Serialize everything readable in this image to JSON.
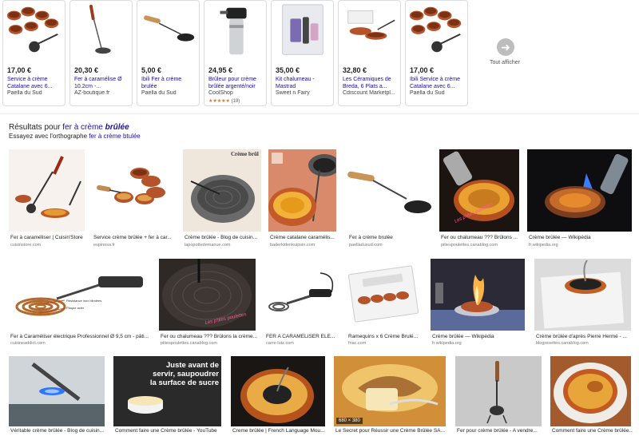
{
  "shopping": {
    "items": [
      {
        "price": "17,00 €",
        "title": "Service à crème Catalane avec 6...",
        "seller": "Paella du Sud",
        "rating": "",
        "rating_count": ""
      },
      {
        "price": "20,30 €",
        "title": "Fer à caramélise Ø 10.2cm -...",
        "seller": "AZ-boutique.fr",
        "rating": "",
        "rating_count": ""
      },
      {
        "price": "5,00 €",
        "title": "Ibili Fer à crème brulée",
        "seller": "Paella du Sud",
        "rating": "",
        "rating_count": ""
      },
      {
        "price": "24,95 €",
        "title": "Brûleur pour crème brûlée argenté/noir",
        "seller": "CoolShop",
        "rating": "★★★★★",
        "rating_count": "(19)"
      },
      {
        "price": "35,00 €",
        "title": "Kit chalumeau - Mastrad",
        "seller": "Sweet n Fairy",
        "rating": "",
        "rating_count": ""
      },
      {
        "price": "32,80 €",
        "title": "Les Céramiques de Breda, 6 Plats a...",
        "seller": "Cdiscount Marketpl...",
        "rating": "",
        "rating_count": ""
      },
      {
        "price": "17,00 €",
        "title": "Ibili Service à crème Catalane avec 6...",
        "seller": "Paella du Sud",
        "rating": "",
        "rating_count": ""
      }
    ],
    "show_all_label": "Tout afficher",
    "show_all_icon": "arrow-right-icon"
  },
  "spelling": {
    "results_prefix": "Résultats pour",
    "results_query_plain": "fer à crème",
    "results_query_bold": "brûlée",
    "try_prefix": "Essayez avec l'orthographe",
    "try_query": "fer à crème btulée"
  },
  "images": {
    "row1": [
      {
        "caption": "Fer à caraméliser | Cuisin'Store",
        "source": "cuisinstore.com"
      },
      {
        "caption": "Service crème brûlée + fer à car...",
        "source": "espinosa.fr"
      },
      {
        "caption": "Crème brûlée - Blog de cuisin...",
        "source": "lapopottedemanue.com"
      },
      {
        "caption": "Crème catalane caramélis...",
        "source": "baderkidenkuipsin.com"
      },
      {
        "caption": "Fer à crème brulée",
        "source": "paelladusud.com"
      },
      {
        "caption": "Fer ou chalumeau ??? Brûlons ...",
        "source": "pitiespoulettes.canablog.com"
      },
      {
        "caption": "Crème brûlée — Wikipédia",
        "source": "fr.wikipedia.org"
      }
    ],
    "row2": [
      {
        "caption": "Fer à Caraméliser électrique Professionnel Ø 9,5 cm - pâti...",
        "source": "cuisineaddict.com"
      },
      {
        "caption": "Fer ou chalumeau ??? Brûlons la crème...",
        "source": "pitiespoulettes.canablog.com"
      },
      {
        "caption": "FER A CARAMELISER ELE...",
        "source": "carre-lutz.com"
      },
      {
        "caption": "Ramequins x 6 Crème Brulé...",
        "source": "fnac.com"
      },
      {
        "caption": "Crème brûlée — Wikipédia",
        "source": "fr.wikipedia.org"
      },
      {
        "caption": "Crème brûlée d'après Pierre Hermé - ...",
        "source": "blogresettes.canablog.com"
      }
    ],
    "row3": [
      {
        "caption": "Véritable crème brûlée - Blog de cuisin...",
        "source": ""
      },
      {
        "caption": "Comment faire une Crème brûlée - YouTube",
        "source": ""
      },
      {
        "caption": "Creme brûlée | French Language Mou...",
        "source": ""
      },
      {
        "caption": "Le Secret pour Réussir une Crème Brûlée SA...",
        "source": ""
      },
      {
        "caption": "Fer pour crème brûlée - A vendre...",
        "source": ""
      },
      {
        "caption": "Comment faire une Crème brûlée...",
        "source": ""
      }
    ],
    "img_text_creme": "Crème brûl",
    "img_text_poulettes": "Les p'tites poulettes",
    "img_text_resistance": "Résistance inox blindées",
    "img_text_plaque": "Plaque acier",
    "img_text_juste": "Juste avant de servir, saupoudrer la surface de sucre",
    "img_dim": "680 × 380"
  },
  "colors": {
    "link": "#1a0dab",
    "star": "#e7711b",
    "divider": "#ebebeb"
  }
}
